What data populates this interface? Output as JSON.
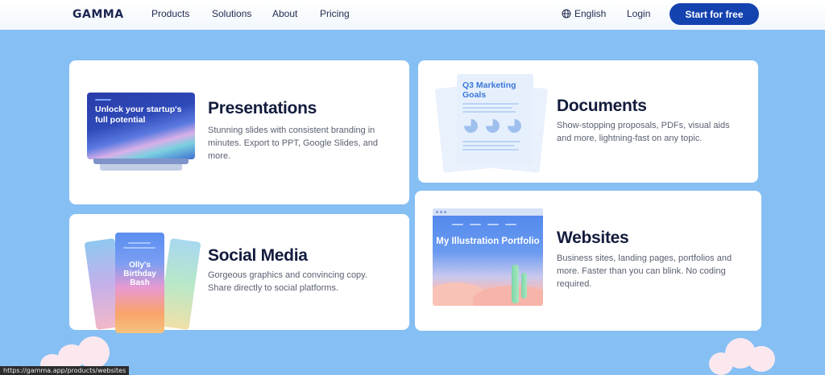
{
  "header": {
    "logo": "GAMMA",
    "nav": [
      "Products",
      "Solutions",
      "About",
      "Pricing"
    ],
    "language": "English",
    "login": "Login",
    "cta": "Start for free"
  },
  "cards": {
    "presentations": {
      "title": "Presentations",
      "description": "Stunning slides with consistent branding in minutes. Export to PPT, Google Slides, and more.",
      "illustration_text": "Unlock your startup's full potential"
    },
    "documents": {
      "title": "Documents",
      "description": "Show-stopping proposals, PDFs, visual aids and more, lightning-fast on any topic.",
      "illustration_text": "Q3 Marketing Goals"
    },
    "social": {
      "title": "Social Media",
      "description": "Gorgeous graphics and convincing copy. Share directly to social platforms.",
      "illustration_text": "Olly's Birthday Bash"
    },
    "websites": {
      "title": "Websites",
      "description": "Business sites, landing pages, portfolios and more. Faster than you can blink. No coding required.",
      "illustration_text": "My Illustration Portfolio"
    }
  },
  "status_url": "https://gamma.app/products/websites",
  "colors": {
    "background": "#86bff4",
    "cta": "#1443b0",
    "title": "#131c3d"
  }
}
